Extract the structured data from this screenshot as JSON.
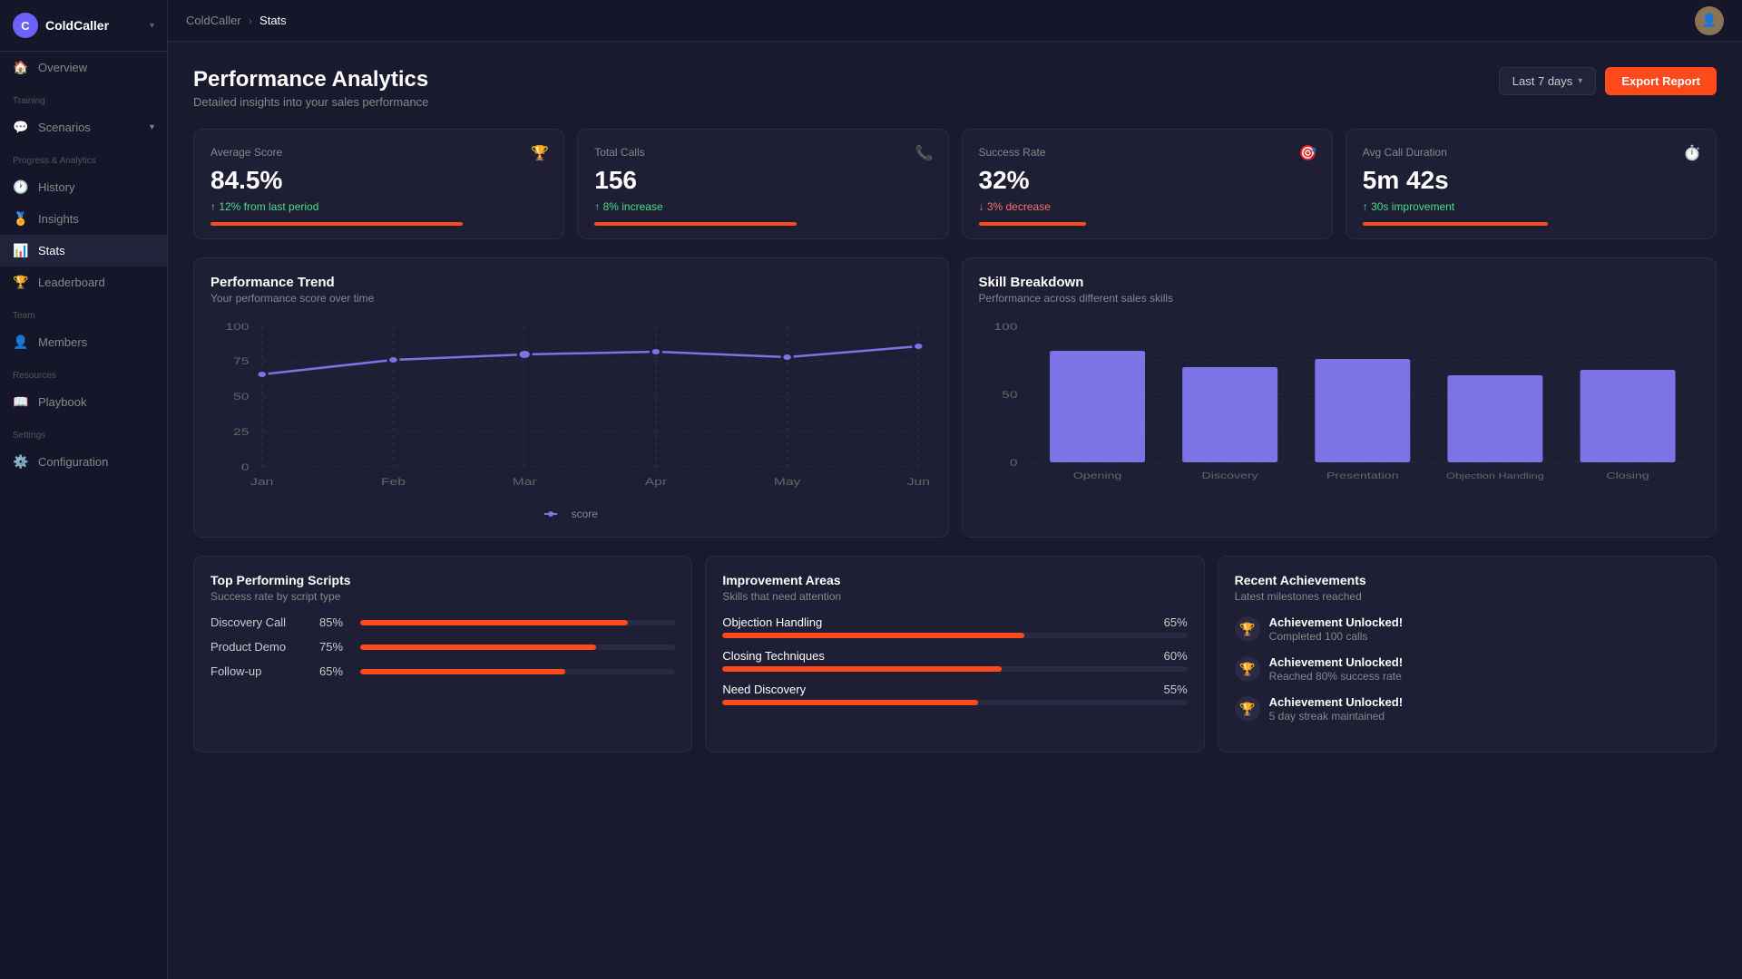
{
  "app": {
    "name": "ColdCaller",
    "page": "Stats",
    "logo_initial": "C"
  },
  "sidebar": {
    "sections": [
      {
        "label": "",
        "items": [
          {
            "id": "overview",
            "label": "Overview",
            "icon": "🏠",
            "active": false
          }
        ]
      },
      {
        "label": "Training",
        "items": [
          {
            "id": "scenarios",
            "label": "Scenarios",
            "icon": "💬",
            "active": false,
            "hasChevron": true
          }
        ]
      },
      {
        "label": "Progress & Analytics",
        "items": [
          {
            "id": "history",
            "label": "History",
            "icon": "🕐",
            "active": false
          },
          {
            "id": "insights",
            "label": "Insights",
            "icon": "🏅",
            "active": false
          },
          {
            "id": "stats",
            "label": "Stats",
            "icon": "📊",
            "active": true
          },
          {
            "id": "leaderboard",
            "label": "Leaderboard",
            "icon": "🏆",
            "active": false
          }
        ]
      },
      {
        "label": "Team",
        "items": [
          {
            "id": "members",
            "label": "Members",
            "icon": "👤",
            "active": false
          }
        ]
      },
      {
        "label": "Resources",
        "items": [
          {
            "id": "playbook",
            "label": "Playbook",
            "icon": "📖",
            "active": false
          }
        ]
      },
      {
        "label": "Settings",
        "items": [
          {
            "id": "configuration",
            "label": "Configuration",
            "icon": "⚙️",
            "active": false
          }
        ]
      }
    ]
  },
  "page": {
    "title": "Performance Analytics",
    "subtitle": "Detailed insights into your sales performance"
  },
  "header": {
    "date_range": "Last 7 days",
    "export_label": "Export Report"
  },
  "stat_cards": [
    {
      "label": "Average Score",
      "value": "84.5%",
      "change": "↑ 12% from last period",
      "change_type": "up",
      "bar_width": "75%",
      "icon": "🏆"
    },
    {
      "label": "Total Calls",
      "value": "156",
      "change": "↑ 8% increase",
      "change_type": "up",
      "bar_width": "60%",
      "icon": "📞"
    },
    {
      "label": "Success Rate",
      "value": "32%",
      "change": "↓ 3% decrease",
      "change_type": "down",
      "bar_width": "32%",
      "icon": "🎯"
    },
    {
      "label": "Avg Call Duration",
      "value": "5m 42s",
      "change": "↑ 30s improvement",
      "change_type": "up",
      "bar_width": "55%",
      "icon": "⏱️"
    }
  ],
  "performance_trend": {
    "title": "Performance Trend",
    "subtitle": "Your performance score over time",
    "x_labels": [
      "Jan",
      "Feb",
      "Mar",
      "Apr",
      "May",
      "Jun"
    ],
    "y_labels": [
      "0",
      "25",
      "50",
      "75",
      "100"
    ],
    "data_points": [
      {
        "x": 0,
        "y": 66
      },
      {
        "x": 1,
        "y": 76
      },
      {
        "x": 2,
        "y": 80
      },
      {
        "x": 3,
        "y": 82
      },
      {
        "x": 4,
        "y": 78
      },
      {
        "x": 5,
        "y": 86
      }
    ],
    "legend_label": "score"
  },
  "skill_breakdown": {
    "title": "Skill Breakdown",
    "subtitle": "Performance across different sales skills",
    "bars": [
      {
        "label": "Opening",
        "value": 82
      },
      {
        "label": "Discovery",
        "value": 70
      },
      {
        "label": "Presentation",
        "value": 76
      },
      {
        "label": "Objection Handling",
        "value": 64
      },
      {
        "label": "Closing",
        "value": 68
      }
    ]
  },
  "top_scripts": {
    "title": "Top Performing Scripts",
    "subtitle": "Success rate by script type",
    "items": [
      {
        "name": "Discovery Call",
        "pct": 85,
        "label": "85%"
      },
      {
        "name": "Product Demo",
        "pct": 75,
        "label": "75%"
      },
      {
        "name": "Follow-up",
        "pct": 65,
        "label": "65%"
      }
    ]
  },
  "improvement_areas": {
    "title": "Improvement Areas",
    "subtitle": "Skills that need attention",
    "items": [
      {
        "name": "Objection Handling",
        "pct": 65,
        "label": "65%"
      },
      {
        "name": "Closing Techniques",
        "pct": 60,
        "label": "60%"
      },
      {
        "name": "Need Discovery",
        "pct": 55,
        "label": "55%"
      }
    ]
  },
  "achievements": {
    "title": "Recent Achievements",
    "subtitle": "Latest milestones reached",
    "items": [
      {
        "title": "Achievement Unlocked!",
        "desc": "Completed 100 calls",
        "icon": "🏆"
      },
      {
        "title": "Achievement Unlocked!",
        "desc": "Reached 80% success rate",
        "icon": "🏆"
      },
      {
        "title": "Achievement Unlocked!",
        "desc": "5 day streak maintained",
        "icon": "🏆"
      }
    ]
  }
}
